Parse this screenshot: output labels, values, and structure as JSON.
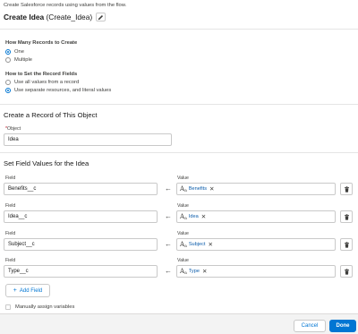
{
  "header": {
    "description": "Create Salesforce records using values from the flow.",
    "title": "Create Idea",
    "api_name": "(Create_Idea)"
  },
  "how_many": {
    "label": "How Many Records to Create",
    "options": [
      {
        "label": "One",
        "selected": true
      },
      {
        "label": "Multiple",
        "selected": false
      }
    ]
  },
  "how_set": {
    "label": "How to Set the Record Fields",
    "options": [
      {
        "label": "Use all values from a record",
        "selected": false
      },
      {
        "label": "Use separate resources, and literal values",
        "selected": true
      }
    ]
  },
  "object_section": {
    "heading": "Create a Record of This Object",
    "object_label": "Object",
    "required_mark": "*",
    "object_value": "Idea"
  },
  "field_values": {
    "heading": "Set Field Values for the Idea",
    "field_label": "Field",
    "value_label": "Value",
    "arrow": "←",
    "rows": [
      {
        "field": "Benefits__c",
        "value": "Benefits"
      },
      {
        "field": "Idea__c",
        "value": "Idea"
      },
      {
        "field": "Subject__c",
        "value": "Subject"
      },
      {
        "field": "Type__c",
        "value": "Type"
      }
    ]
  },
  "add_field_label": "Add Field",
  "manual_assign_label": "Manually assign variables",
  "footer": {
    "cancel_label": "Cancel",
    "done_label": "Done"
  },
  "colors": {
    "brand": "#0176d3",
    "pill_text": "#0b5cab"
  }
}
